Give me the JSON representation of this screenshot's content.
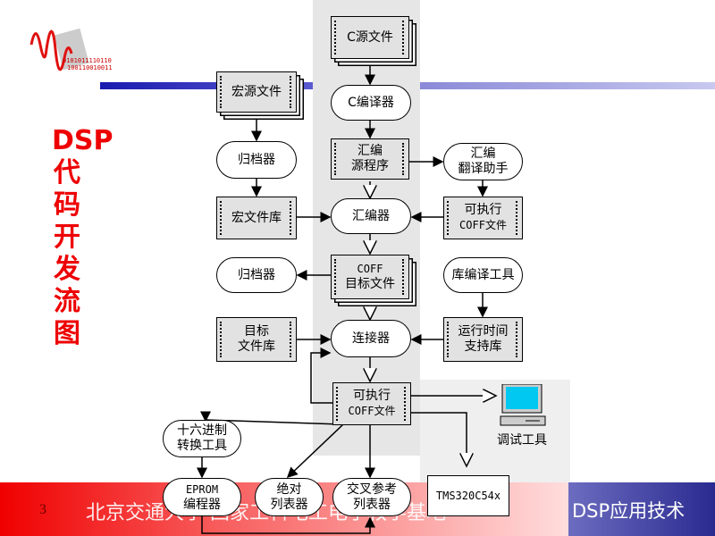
{
  "slide": {
    "title": "DSP代码开发流图",
    "page_number": "3",
    "footer_text": "北京交通大学 国家工科电工电子教学基地",
    "course": "DSP应用技术",
    "logo_text": "0101011110110 10011001001 1"
  },
  "colors": {
    "title": "#ee0000",
    "footer_red": "#f00000",
    "footer_blue": "#2a2a90",
    "accent_bar": "#3a3aa8"
  },
  "nodes": {
    "c_source": "C源文件",
    "macro_source": "宏源文件",
    "c_compiler": "C编译器",
    "archiver1": "归档器",
    "asm_source_1": "汇编",
    "asm_source_2": "源程序",
    "translator_1": "汇编",
    "translator_2": "翻译助手",
    "macro_lib": "宏文件库",
    "assembler": "汇编器",
    "exec_coff_1a": "可执行",
    "exec_coff_1b": "COFF文件",
    "archiver2": "归档器",
    "coff_obj_1": "COFF",
    "coff_obj_2": "目标文件",
    "lib_builder": "库编译工具",
    "obj_lib_1": "目标",
    "obj_lib_2": "文件库",
    "linker": "连接器",
    "rts_lib_1": "运行时间",
    "rts_lib_2": "支持库",
    "exec_coff_2a": "可执行",
    "exec_coff_2b": "COFF文件",
    "debug_tools": "调试工具",
    "hex_conv_1": "十六进制",
    "hex_conv_2": "转换工具",
    "eprom_1": "EPROM",
    "eprom_2": "编程器",
    "abs_lister_1": "绝对",
    "abs_lister_2": "列表器",
    "xref_lister_1": "交叉参考",
    "xref_lister_2": "列表器",
    "target": "TMS320C54x"
  },
  "icons": {
    "debug": "computer-monitor-icon",
    "logo": "waveform-chip-logo"
  }
}
